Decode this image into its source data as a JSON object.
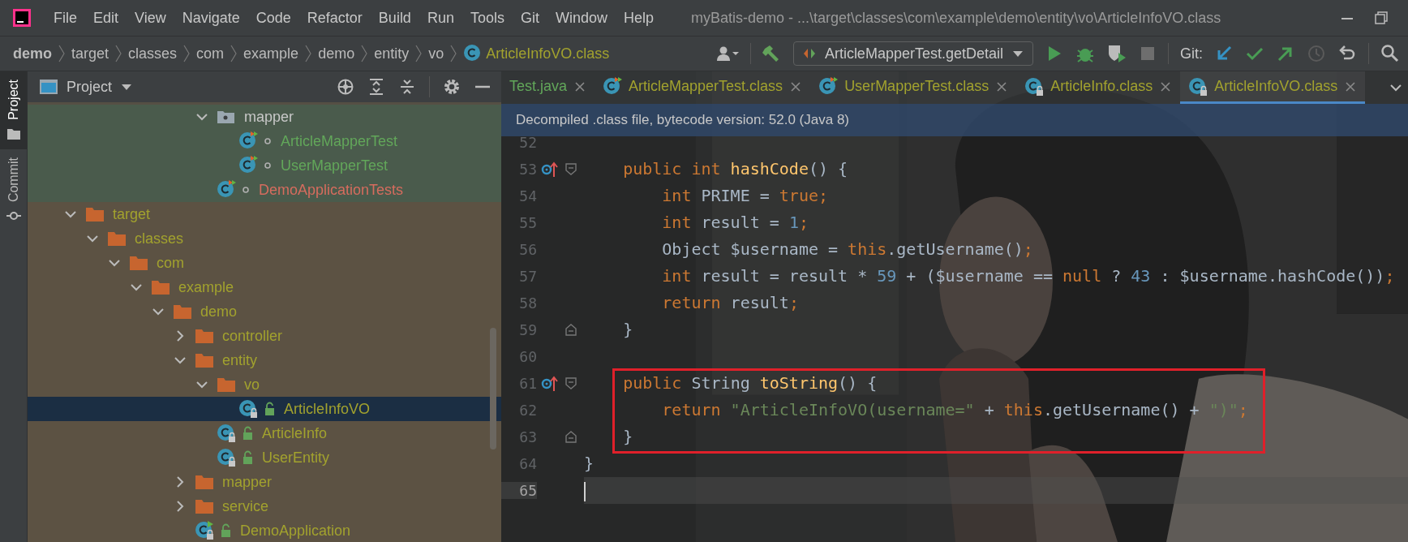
{
  "window": {
    "title": "myBatis-demo - ...\\target\\classes\\com\\example\\demo\\entity\\vo\\ArticleInfoVO.class"
  },
  "menu": [
    "File",
    "Edit",
    "View",
    "Navigate",
    "Code",
    "Refactor",
    "Build",
    "Run",
    "Tools",
    "Git",
    "Window",
    "Help"
  ],
  "breadcrumbs": [
    {
      "label": "demo",
      "kind": "module",
      "color": "#bbbbbb"
    },
    {
      "label": "target",
      "kind": "folder",
      "color": "#bbbbbb"
    },
    {
      "label": "classes",
      "kind": "folder",
      "color": "#bbbbbb"
    },
    {
      "label": "com",
      "kind": "folder",
      "color": "#bbbbbb"
    },
    {
      "label": "example",
      "kind": "folder",
      "color": "#bbbbbb"
    },
    {
      "label": "demo",
      "kind": "folder",
      "color": "#bbbbbb"
    },
    {
      "label": "entity",
      "kind": "folder",
      "color": "#bbbbbb"
    },
    {
      "label": "vo",
      "kind": "folder",
      "color": "#bbbbbb"
    },
    {
      "label": "ArticleInfoVO.class",
      "kind": "class",
      "color": "#a2a22e"
    }
  ],
  "toolbar": {
    "run_config": "ArticleMapperTest.getDetail",
    "git_label": "Git:"
  },
  "side_tabs": [
    {
      "label": "Project",
      "selected": true
    },
    {
      "label": "Commit",
      "selected": false
    }
  ],
  "project_panel": {
    "title": "Project",
    "partial_nodes": [
      {
        "label": "mapper",
        "kind": "package",
        "color": "#c8c8c8",
        "ignored": false,
        "expanded": true,
        "selected": false,
        "children": [
          {
            "label": "ArticleMapperTest",
            "kind": "test-class",
            "color": "#62a75a",
            "ignored": false,
            "selected": false
          },
          {
            "label": "UserMapperTest",
            "kind": "test-class",
            "color": "#62a75a",
            "ignored": false,
            "selected": false
          }
        ]
      },
      {
        "label": "DemoApplicationTests",
        "kind": "test-class",
        "color": "#d66c5e",
        "ignored": false,
        "selected": false
      }
    ],
    "nodes": [
      {
        "label": "target",
        "kind": "folder",
        "color": "#a2a22e",
        "ignored": true,
        "expanded": true,
        "selected": false,
        "children": [
          {
            "label": "classes",
            "kind": "folder",
            "color": "#a2a22e",
            "ignored": true,
            "expanded": true,
            "selected": false,
            "children": [
              {
                "label": "com",
                "kind": "folder",
                "color": "#a2a22e",
                "ignored": true,
                "expanded": true,
                "selected": false,
                "children": [
                  {
                    "label": "example",
                    "kind": "folder",
                    "color": "#a2a22e",
                    "ignored": true,
                    "expanded": true,
                    "selected": false,
                    "children": [
                      {
                        "label": "demo",
                        "kind": "folder",
                        "color": "#a2a22e",
                        "ignored": true,
                        "expanded": true,
                        "selected": false,
                        "children": [
                          {
                            "label": "controller",
                            "kind": "folder",
                            "color": "#a2a22e",
                            "ignored": true,
                            "expanded": false,
                            "selected": false
                          },
                          {
                            "label": "entity",
                            "kind": "folder",
                            "color": "#a2a22e",
                            "ignored": true,
                            "expanded": true,
                            "selected": false,
                            "children": [
                              {
                                "label": "vo",
                                "kind": "folder",
                                "color": "#a2a22e",
                                "ignored": true,
                                "expanded": true,
                                "selected": false,
                                "children": [
                                  {
                                    "label": "ArticleInfoVO",
                                    "kind": "class",
                                    "color": "#a2a22e",
                                    "ignored": true,
                                    "selected": true
                                  }
                                ]
                              },
                              {
                                "label": "ArticleInfo",
                                "kind": "class",
                                "color": "#a2a22e",
                                "ignored": true,
                                "selected": false
                              },
                              {
                                "label": "UserEntity",
                                "kind": "class",
                                "color": "#a2a22e",
                                "ignored": true,
                                "selected": false
                              }
                            ]
                          },
                          {
                            "label": "mapper",
                            "kind": "folder",
                            "color": "#a2a22e",
                            "ignored": true,
                            "expanded": false,
                            "selected": false
                          },
                          {
                            "label": "service",
                            "kind": "folder",
                            "color": "#a2a22e",
                            "ignored": true,
                            "expanded": false,
                            "selected": false
                          },
                          {
                            "label": "DemoApplication",
                            "kind": "main-class",
                            "color": "#a2a22e",
                            "ignored": true,
                            "selected": false
                          }
                        ]
                      }
                    ]
                  }
                ]
              }
            ]
          }
        ]
      }
    ]
  },
  "editor": {
    "tabs": [
      {
        "label": "Test.java",
        "kind": "java",
        "color": "#62a75a",
        "selected": false
      },
      {
        "label": "ArticleMapperTest.class",
        "kind": "test-class",
        "color": "#a2a22e",
        "selected": false
      },
      {
        "label": "UserMapperTest.class",
        "kind": "test-class",
        "color": "#a2a22e",
        "selected": false
      },
      {
        "label": "ArticleInfo.class",
        "kind": "class",
        "color": "#a2a22e",
        "selected": false
      },
      {
        "label": "ArticleInfoVO.class",
        "kind": "class",
        "color": "#a2a22e",
        "selected": true
      }
    ],
    "banner": "Decompiled .class file, bytecode version: 52.0 (Java 8)",
    "lines": [
      {
        "number": "52",
        "override": false,
        "fold_start": false,
        "fold_end": false,
        "highlighted": false,
        "current": false
      },
      {
        "number": "53",
        "override": true,
        "fold_start": true,
        "fold_end": false,
        "highlighted": false,
        "current": false,
        "tokens": [
          {
            "kind": "kw",
            "text": "    public int"
          },
          {
            "kind": "fn",
            "text": " hashCode"
          },
          {
            "kind": "plain",
            "text": "() {"
          }
        ]
      },
      {
        "number": "54",
        "override": false,
        "fold_start": false,
        "fold_end": false,
        "highlighted": false,
        "current": false,
        "tokens": [
          {
            "kind": "kw",
            "text": "        int"
          },
          {
            "kind": "plain",
            "text": " PRIME = "
          },
          {
            "kind": "kw",
            "text": "true;"
          }
        ]
      },
      {
        "number": "55",
        "override": false,
        "fold_start": false,
        "fold_end": false,
        "highlighted": false,
        "current": false,
        "tokens": [
          {
            "kind": "kw",
            "text": "        int"
          },
          {
            "kind": "plain",
            "text": " result = "
          },
          {
            "kind": "num",
            "text": "1"
          },
          {
            "kind": "kw",
            "text": ";"
          }
        ]
      },
      {
        "number": "56",
        "override": false,
        "fold_start": false,
        "fold_end": false,
        "highlighted": false,
        "current": false,
        "tokens": [
          {
            "kind": "plain",
            "text": "        Object $username = "
          },
          {
            "kind": "kw",
            "text": "this"
          },
          {
            "kind": "plain",
            "text": ".getUsername()"
          },
          {
            "kind": "kw",
            "text": ";"
          }
        ]
      },
      {
        "number": "57",
        "override": false,
        "fold_start": false,
        "fold_end": false,
        "highlighted": false,
        "current": false,
        "tokens": [
          {
            "kind": "kw",
            "text": "        int"
          },
          {
            "kind": "plain",
            "text": " result = result * "
          },
          {
            "kind": "num",
            "text": "59"
          },
          {
            "kind": "plain",
            "text": " + ($username == "
          },
          {
            "kind": "kw",
            "text": "null"
          },
          {
            "kind": "plain",
            "text": " ? "
          },
          {
            "kind": "num",
            "text": "43"
          },
          {
            "kind": "plain",
            "text": " : $username.hashCode())"
          },
          {
            "kind": "kw",
            "text": ";"
          }
        ]
      },
      {
        "number": "58",
        "override": false,
        "fold_start": false,
        "fold_end": false,
        "highlighted": false,
        "current": false,
        "tokens": [
          {
            "kind": "kw",
            "text": "        return"
          },
          {
            "kind": "plain",
            "text": " result"
          },
          {
            "kind": "kw",
            "text": ";"
          }
        ]
      },
      {
        "number": "59",
        "override": false,
        "fold_start": false,
        "fold_end": true,
        "highlighted": false,
        "current": false,
        "tokens": [
          {
            "kind": "plain",
            "text": "    }"
          }
        ]
      },
      {
        "number": "60",
        "override": false,
        "fold_start": false,
        "fold_end": false,
        "highlighted": false,
        "current": false
      },
      {
        "number": "61",
        "override": true,
        "fold_start": true,
        "fold_end": false,
        "highlighted": true,
        "current": false,
        "tokens": [
          {
            "kind": "kw",
            "text": "    public"
          },
          {
            "kind": "plain",
            "text": " String "
          },
          {
            "kind": "fn",
            "text": "toString"
          },
          {
            "kind": "plain",
            "text": "() {"
          }
        ]
      },
      {
        "number": "62",
        "override": false,
        "fold_start": false,
        "fold_end": false,
        "highlighted": true,
        "current": false,
        "tokens": [
          {
            "kind": "kw",
            "text": "        return"
          },
          {
            "kind": "str",
            "text": " \"ArticleInfoVO(username=\""
          },
          {
            "kind": "plain",
            "text": " + "
          },
          {
            "kind": "kw",
            "text": "this"
          },
          {
            "kind": "plain",
            "text": ".getUsername() + "
          },
          {
            "kind": "str",
            "text": "\")\""
          },
          {
            "kind": "kw",
            "text": ";"
          }
        ]
      },
      {
        "number": "63",
        "override": false,
        "fold_start": false,
        "fold_end": true,
        "highlighted": true,
        "current": false,
        "tokens": [
          {
            "kind": "plain",
            "text": "    }"
          }
        ]
      },
      {
        "number": "64",
        "override": false,
        "fold_start": false,
        "fold_end": false,
        "highlighted": false,
        "current": false,
        "tokens": [
          {
            "kind": "plain",
            "text": "}"
          }
        ]
      },
      {
        "number": "65",
        "override": false,
        "fold_start": false,
        "fold_end": false,
        "highlighted": false,
        "current": true
      }
    ]
  }
}
